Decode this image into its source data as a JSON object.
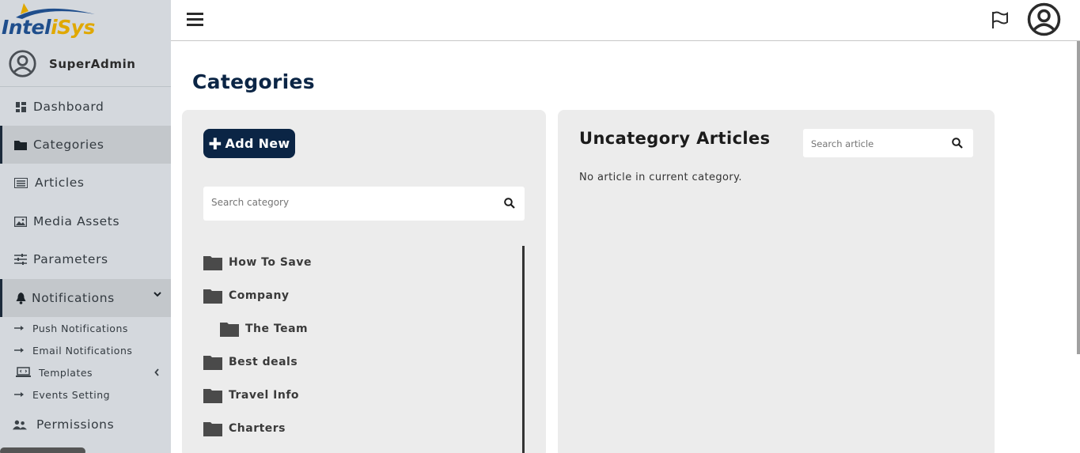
{
  "brand": {
    "name_part1": "Intel",
    "name_part2": "iSys",
    "colors": {
      "primary": "#1f4e8c",
      "accent": "#e0a800"
    }
  },
  "user": {
    "name": "SuperAdmin",
    "icon": "user-circle-icon"
  },
  "sidebar": {
    "items": [
      {
        "label": "Dashboard",
        "icon": "dashboard-icon"
      },
      {
        "label": "Categories",
        "icon": "folder-icon"
      },
      {
        "label": "Articles",
        "icon": "list-icon"
      },
      {
        "label": "Media Assets",
        "icon": "image-icon"
      },
      {
        "label": "Parameters",
        "icon": "sliders-icon"
      },
      {
        "label": "Notifications",
        "icon": "bell-icon"
      },
      {
        "label": "Permissions",
        "icon": "users-icon"
      }
    ],
    "notifications_sub": [
      {
        "label": "Push Notifications",
        "icon": "arrow-right-icon"
      },
      {
        "label": "Email Notifications",
        "icon": "arrow-right-icon"
      },
      {
        "label": "Templates",
        "icon": "laptop-code-icon"
      },
      {
        "label": "Events Setting",
        "icon": "arrow-right-icon"
      }
    ]
  },
  "topbar": {
    "menu_icon": "hamburger-icon",
    "flag_icon": "flag-icon",
    "profile_icon": "user-circle-icon"
  },
  "page": {
    "title": "Categories"
  },
  "categories_panel": {
    "add_button": "Add New",
    "search_placeholder": "Search category",
    "tree": [
      {
        "label": "How To Save",
        "level": 0
      },
      {
        "label": "Company",
        "level": 0
      },
      {
        "label": "The Team",
        "level": 1
      },
      {
        "label": "Best deals",
        "level": 0
      },
      {
        "label": "Travel Info",
        "level": 0
      },
      {
        "label": "Charters",
        "level": 0
      }
    ]
  },
  "articles_panel": {
    "title": "Uncategory Articles",
    "search_placeholder": "Search article",
    "empty_message": "No article in current category."
  }
}
